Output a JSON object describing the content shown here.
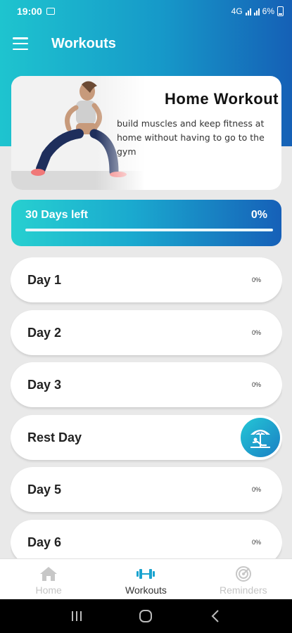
{
  "status_bar": {
    "time": "19:00",
    "network": "4G",
    "battery": "6%"
  },
  "app_bar": {
    "title": "Workouts",
    "menu_icon": "hamburger-icon"
  },
  "hero": {
    "title": "Home Workout",
    "description": "build muscles and keep fitness at home without having to go to the gym"
  },
  "progress": {
    "label": "30 Days left",
    "percent_text": "0%",
    "value": 0
  },
  "days": [
    {
      "label": "Day 1",
      "percent": "0%"
    },
    {
      "label": "Day 2",
      "percent": "0%"
    },
    {
      "label": "Day 3",
      "percent": "0%"
    },
    {
      "label": "Rest Day",
      "icon": "rest-beach-icon"
    },
    {
      "label": "Day 5",
      "percent": "0%"
    },
    {
      "label": "Day 6",
      "percent": "0%"
    }
  ],
  "bottom_nav": [
    {
      "label": "Home",
      "icon": "home-icon",
      "active": false
    },
    {
      "label": "Workouts",
      "icon": "dumbbell-icon",
      "active": true
    },
    {
      "label": "Reminders",
      "icon": "reminder-icon",
      "active": false
    }
  ],
  "colors": {
    "accent": "#1699c9",
    "accent_dark": "#1560b6",
    "accent_light": "#1ec4cf"
  }
}
